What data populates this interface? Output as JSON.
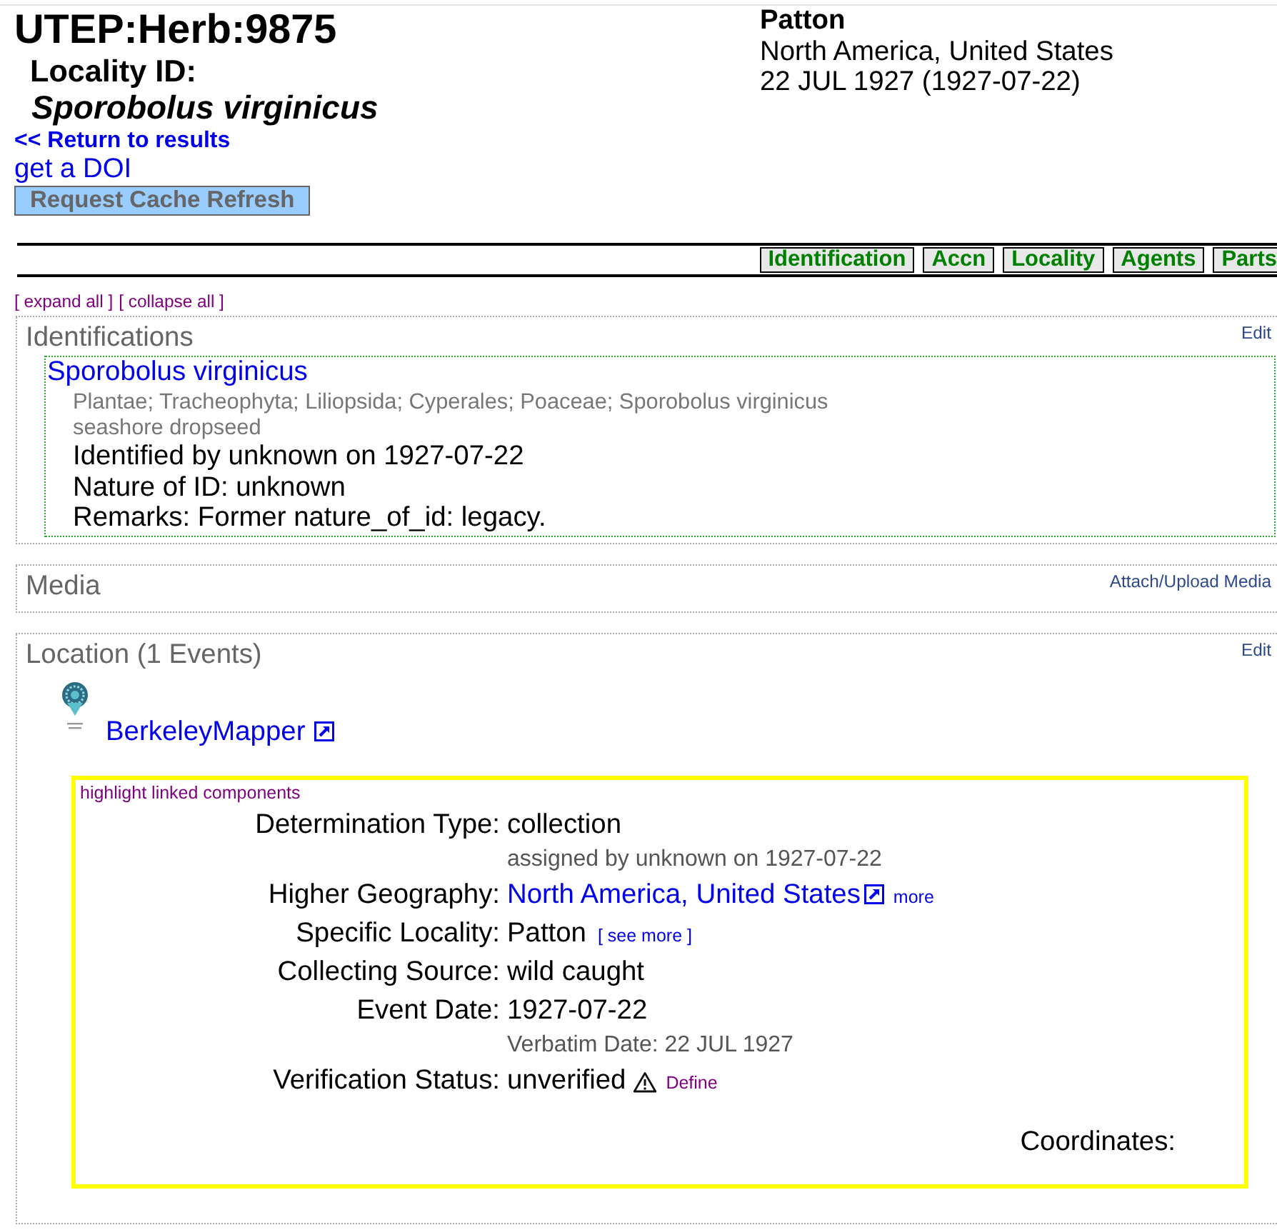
{
  "record": {
    "title": "UTEP:Herb:9875",
    "locality_id_label": "Locality ID:",
    "scientific_name": "Sporobolus virginicus",
    "return_link": "<< Return to results",
    "doi_link": "get a DOI",
    "cache_button": "Request Cache Refresh"
  },
  "summary": {
    "locality": "Patton",
    "geography": "North America, United States",
    "date": "22 JUL 1927 (1927-07-22)"
  },
  "tabs": [
    {
      "label": "Identification"
    },
    {
      "label": "Accn"
    },
    {
      "label": "Locality"
    },
    {
      "label": "Agents"
    },
    {
      "label": "Parts"
    }
  ],
  "outline_controls": {
    "expand": "[ expand all ]",
    "collapse": "[ collapse all ]"
  },
  "sections": [
    {
      "kind": "identifications",
      "title": "Identifications",
      "action": "Edit",
      "identifications": [
        {
          "name": "Sporobolus virginicus",
          "taxonomy": "Plantae; Tracheophyta; Liliopsida; Cyperales; Poaceae; Sporobolus virginicus",
          "common_name": "seashore dropseed",
          "details": [
            "Identified by unknown on 1927-07-22",
            "Nature of ID: unknown",
            "Remarks: Former nature_of_id: legacy."
          ]
        }
      ]
    },
    {
      "kind": "media",
      "title": "Media",
      "action": "Attach/Upload Media"
    },
    {
      "kind": "location",
      "title": "Location (1 Events)",
      "action": "Edit",
      "mapper_link": "BerkeleyMapper",
      "event": {
        "highlight_link": "highlight linked components",
        "fields": [
          {
            "kind": "text",
            "label": "Determination Type:",
            "value": "collection",
            "note": "assigned by unknown on 1927-07-22"
          },
          {
            "kind": "external_link",
            "label": "Higher Geography:",
            "value": "North America, United States",
            "extra": "more"
          },
          {
            "kind": "text",
            "label": "Specific Locality:",
            "value": "Patton",
            "extra": "[ see more ]"
          },
          {
            "kind": "text",
            "label": "Collecting Source:",
            "value": "wild caught"
          },
          {
            "kind": "text",
            "label": "Event Date:",
            "value": "1927-07-22",
            "note": "Verbatim Date: 22 JUL 1927"
          },
          {
            "kind": "warning",
            "label": "Verification Status:",
            "value": "unverified",
            "extra": "Define"
          }
        ],
        "coordinates_label": "Coordinates:"
      }
    }
  ]
}
